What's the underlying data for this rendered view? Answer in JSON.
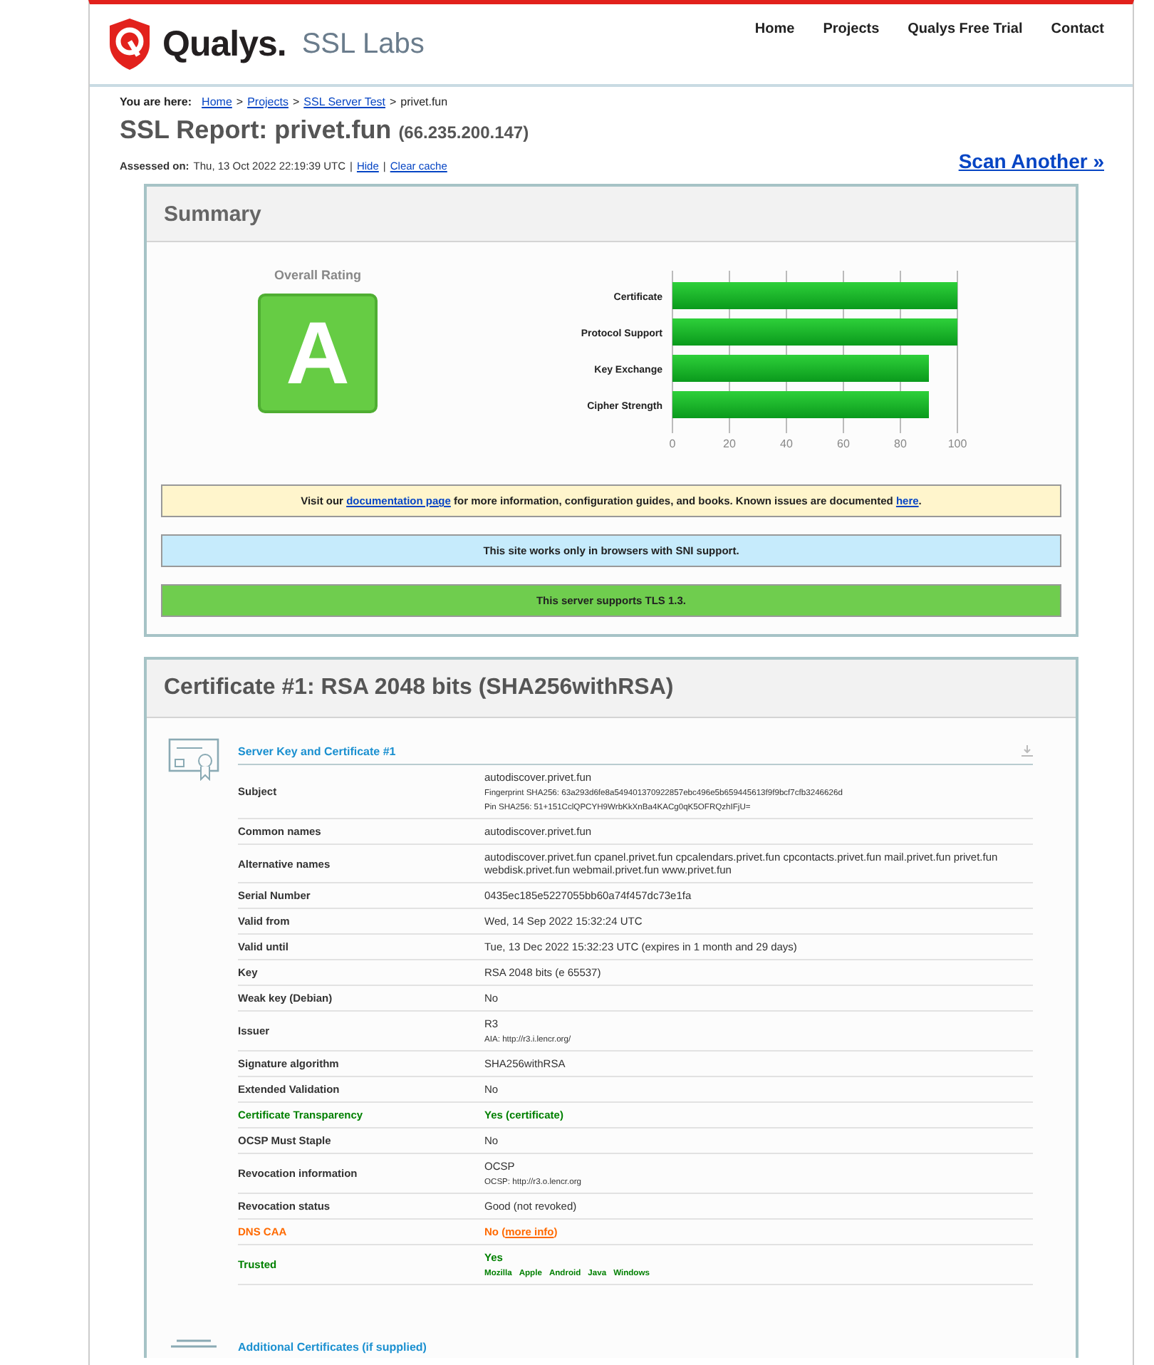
{
  "header": {
    "brand": "Qualys.",
    "product": "SSL Labs",
    "nav": [
      "Home",
      "Projects",
      "Qualys Free Trial",
      "Contact"
    ]
  },
  "breadcrumb": {
    "prefix": "You are here:",
    "links": [
      "Home",
      "Projects",
      "SSL Server Test"
    ],
    "separator": ">",
    "current": "privet.fun"
  },
  "report": {
    "title": "SSL Report: privet.fun",
    "ip": "(66.235.200.147)",
    "assessed_label": "Assessed on:",
    "assessed_value": "Thu, 13 Oct 2022 22:19:39 UTC",
    "separator": "|",
    "links": [
      "Hide",
      "Clear cache"
    ],
    "scan_another": "Scan Another »"
  },
  "summary": {
    "title": "Summary",
    "rating_label": "Overall Rating",
    "grade": "A",
    "chart_data": {
      "type": "bar",
      "orientation": "horizontal",
      "categories": [
        "Certificate",
        "Protocol Support",
        "Key Exchange",
        "Cipher Strength"
      ],
      "values": [
        100,
        100,
        90,
        90
      ],
      "xlim": [
        0,
        100
      ],
      "xticks": [
        0,
        20,
        40,
        60,
        80,
        100
      ],
      "grid": true
    },
    "notices": [
      {
        "color": "#fff5cc",
        "parts": [
          {
            "kind": "text",
            "text": "Visit our "
          },
          {
            "kind": "link",
            "text": "documentation page"
          },
          {
            "kind": "text",
            "text": " for more information, configuration guides, and books. Known issues are documented "
          },
          {
            "kind": "link",
            "text": "here"
          },
          {
            "kind": "text",
            "text": "."
          }
        ]
      },
      {
        "color": "#c6ebfc",
        "parts": [
          {
            "kind": "text",
            "text": "This site works only in browsers with SNI support."
          }
        ]
      },
      {
        "color": "#6fcd4e",
        "parts": [
          {
            "kind": "text",
            "text": "This server supports TLS 1.3."
          }
        ]
      }
    ]
  },
  "certificate": {
    "title": "Certificate #1: RSA 2048 bits (SHA256withRSA)",
    "section_title": "Server Key and Certificate #1",
    "rows": [
      {
        "label": "Subject",
        "kind": "normal",
        "value": "autodiscover.privet.fun",
        "details": [
          "Fingerprint SHA256: 63a293d6fe8a549401370922857ebc496e5b659445613f9f9bcf7cfb3246626d",
          "Pin SHA256: 51+151CclQPCYH9WrbKkXnBa4KACg0qK5OFRQzhIFjU="
        ]
      },
      {
        "label": "Common names",
        "kind": "normal",
        "value": "autodiscover.privet.fun"
      },
      {
        "label": "Alternative names",
        "kind": "normal",
        "value": "autodiscover.privet.fun cpanel.privet.fun cpcalendars.privet.fun cpcontacts.privet.fun mail.privet.fun privet.fun webdisk.privet.fun webmail.privet.fun www.privet.fun"
      },
      {
        "label": "Serial Number",
        "kind": "normal",
        "value": "0435ec185e5227055bb60a74f457dc73e1fa"
      },
      {
        "label": "Valid from",
        "kind": "normal",
        "value": "Wed, 14 Sep 2022 15:32:24 UTC"
      },
      {
        "label": "Valid until",
        "kind": "normal",
        "value": "Tue, 13 Dec 2022 15:32:23 UTC (expires in 1 month and 29 days)"
      },
      {
        "label": "Key",
        "kind": "normal",
        "value": "RSA 2048 bits (e 65537)"
      },
      {
        "label": "Weak key (Debian)",
        "kind": "normal",
        "value": "No"
      },
      {
        "label": "Issuer",
        "kind": "normal",
        "value": "R3",
        "details": [
          "AIA: http://r3.i.lencr.org/"
        ]
      },
      {
        "label": "Signature algorithm",
        "kind": "normal",
        "value": "SHA256withRSA"
      },
      {
        "label": "Extended Validation",
        "kind": "normal",
        "value": "No"
      },
      {
        "label": "Certificate Transparency",
        "kind": "good",
        "value": "Yes (certificate)"
      },
      {
        "label": "OCSP Must Staple",
        "kind": "normal",
        "value": "No"
      },
      {
        "label": "Revocation information",
        "kind": "normal",
        "value": "OCSP",
        "details": [
          "OCSP: http://r3.o.lencr.org"
        ]
      },
      {
        "label": "Revocation status",
        "kind": "normal",
        "value": "Good (not revoked)"
      },
      {
        "label": "DNS CAA",
        "kind": "warning",
        "value": "No (",
        "link": "more info",
        "suffix": ")"
      },
      {
        "label": "Trusted",
        "kind": "good",
        "value": "Yes",
        "stores": [
          "Mozilla",
          "Apple",
          "Android",
          "Java",
          "Windows"
        ]
      }
    ],
    "next_section_title": "Additional Certificates (if supplied)"
  }
}
